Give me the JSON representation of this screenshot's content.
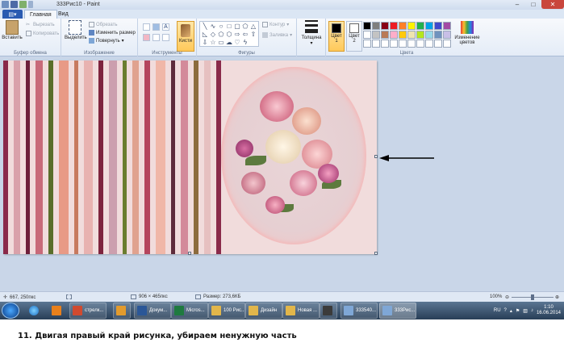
{
  "window": {
    "title": "333Рис10 - Paint",
    "controls": {
      "minimize": "–",
      "maximize": "□",
      "close": "✕"
    }
  },
  "tabs": {
    "file_icon": "menu-icon",
    "home": "Главная",
    "view": "Вид"
  },
  "ribbon": {
    "clipboard": {
      "label": "Буфер обмена",
      "paste": "Вставить",
      "cut": "Вырезать",
      "copy": "Копировать"
    },
    "image": {
      "label": "Изображение",
      "select": "Выделить",
      "crop": "Обрезать",
      "resize": "Изменить размер",
      "rotate": "Повернуть"
    },
    "tools": {
      "label": "Инструменты",
      "brushes": "Кисти"
    },
    "shapes": {
      "label": "Фигуры",
      "outline": "Контур",
      "fill": "Заливка"
    },
    "size": {
      "label": "Толщина"
    },
    "colors": {
      "label": "Цвета",
      "color1": "Цвет 1",
      "color2": "Цвет 2",
      "color1_value": "#000000",
      "color2_value": "#ffffff",
      "edit": "Изменение цветов",
      "palette": [
        "#000000",
        "#7f7f7f",
        "#880015",
        "#ed1c24",
        "#ff7f27",
        "#fff200",
        "#22b14c",
        "#00a2e8",
        "#3f48cc",
        "#a349a4",
        "#ffffff",
        "#c3c3c3",
        "#b97a57",
        "#ffaec9",
        "#ffc90e",
        "#efe4b0",
        "#b5e61d",
        "#99d9ea",
        "#7092be",
        "#c8bfe7",
        "#ffffff",
        "#ffffff",
        "#ffffff",
        "#ffffff",
        "#ffffff",
        "#ffffff",
        "#ffffff",
        "#ffffff",
        "#ffffff",
        "#ffffff"
      ]
    }
  },
  "canvas": {
    "stripes": [
      "#8a2a4a",
      "#d9a1aa",
      "#6e1f3a",
      "#c86a79",
      "#5a6e2a",
      "#e89a86",
      "#c77a5f",
      "#e8b2b0",
      "#7e243e",
      "#cc9fae",
      "#6b7d2f",
      "#e0a28f",
      "#b5455d",
      "#f0b7a8",
      "#5e2b3b",
      "#d38a9a",
      "#8c6b3d",
      "#e6c0c0",
      "#8a2a4a"
    ],
    "stripe_count": 19
  },
  "status": {
    "cursor": "667, 250пкс",
    "selection": "",
    "dimensions": "906 × 465пкс",
    "size": "Размер: 273,6КБ",
    "zoom": "100%"
  },
  "taskbar": {
    "items": [
      {
        "label": "стрелк...",
        "icon_color": "#d04a2f"
      },
      {
        "label": "",
        "icon_color": "#e39b2d"
      },
      {
        "label": "Докум...",
        "icon_color": "#2b5797"
      },
      {
        "label": "Micros...",
        "icon_color": "#1f7a3f"
      },
      {
        "label": "100 Рис...",
        "icon_color": "#e2b64a"
      },
      {
        "label": "Дизайн",
        "icon_color": "#e2b64a"
      },
      {
        "label": "Новая ...",
        "icon_color": "#e2b64a"
      },
      {
        "label": "",
        "icon_color": "#3b3b3b"
      },
      {
        "label": "333540...",
        "icon_color": "#7fa7d6"
      },
      {
        "label": "333Рис...",
        "icon_color": "#7fa7d6"
      }
    ],
    "lang": "RU",
    "time": "1:10",
    "date": "16.06.2014"
  },
  "caption": "11. Двигая правый край рисунка, убираем ненужную часть"
}
